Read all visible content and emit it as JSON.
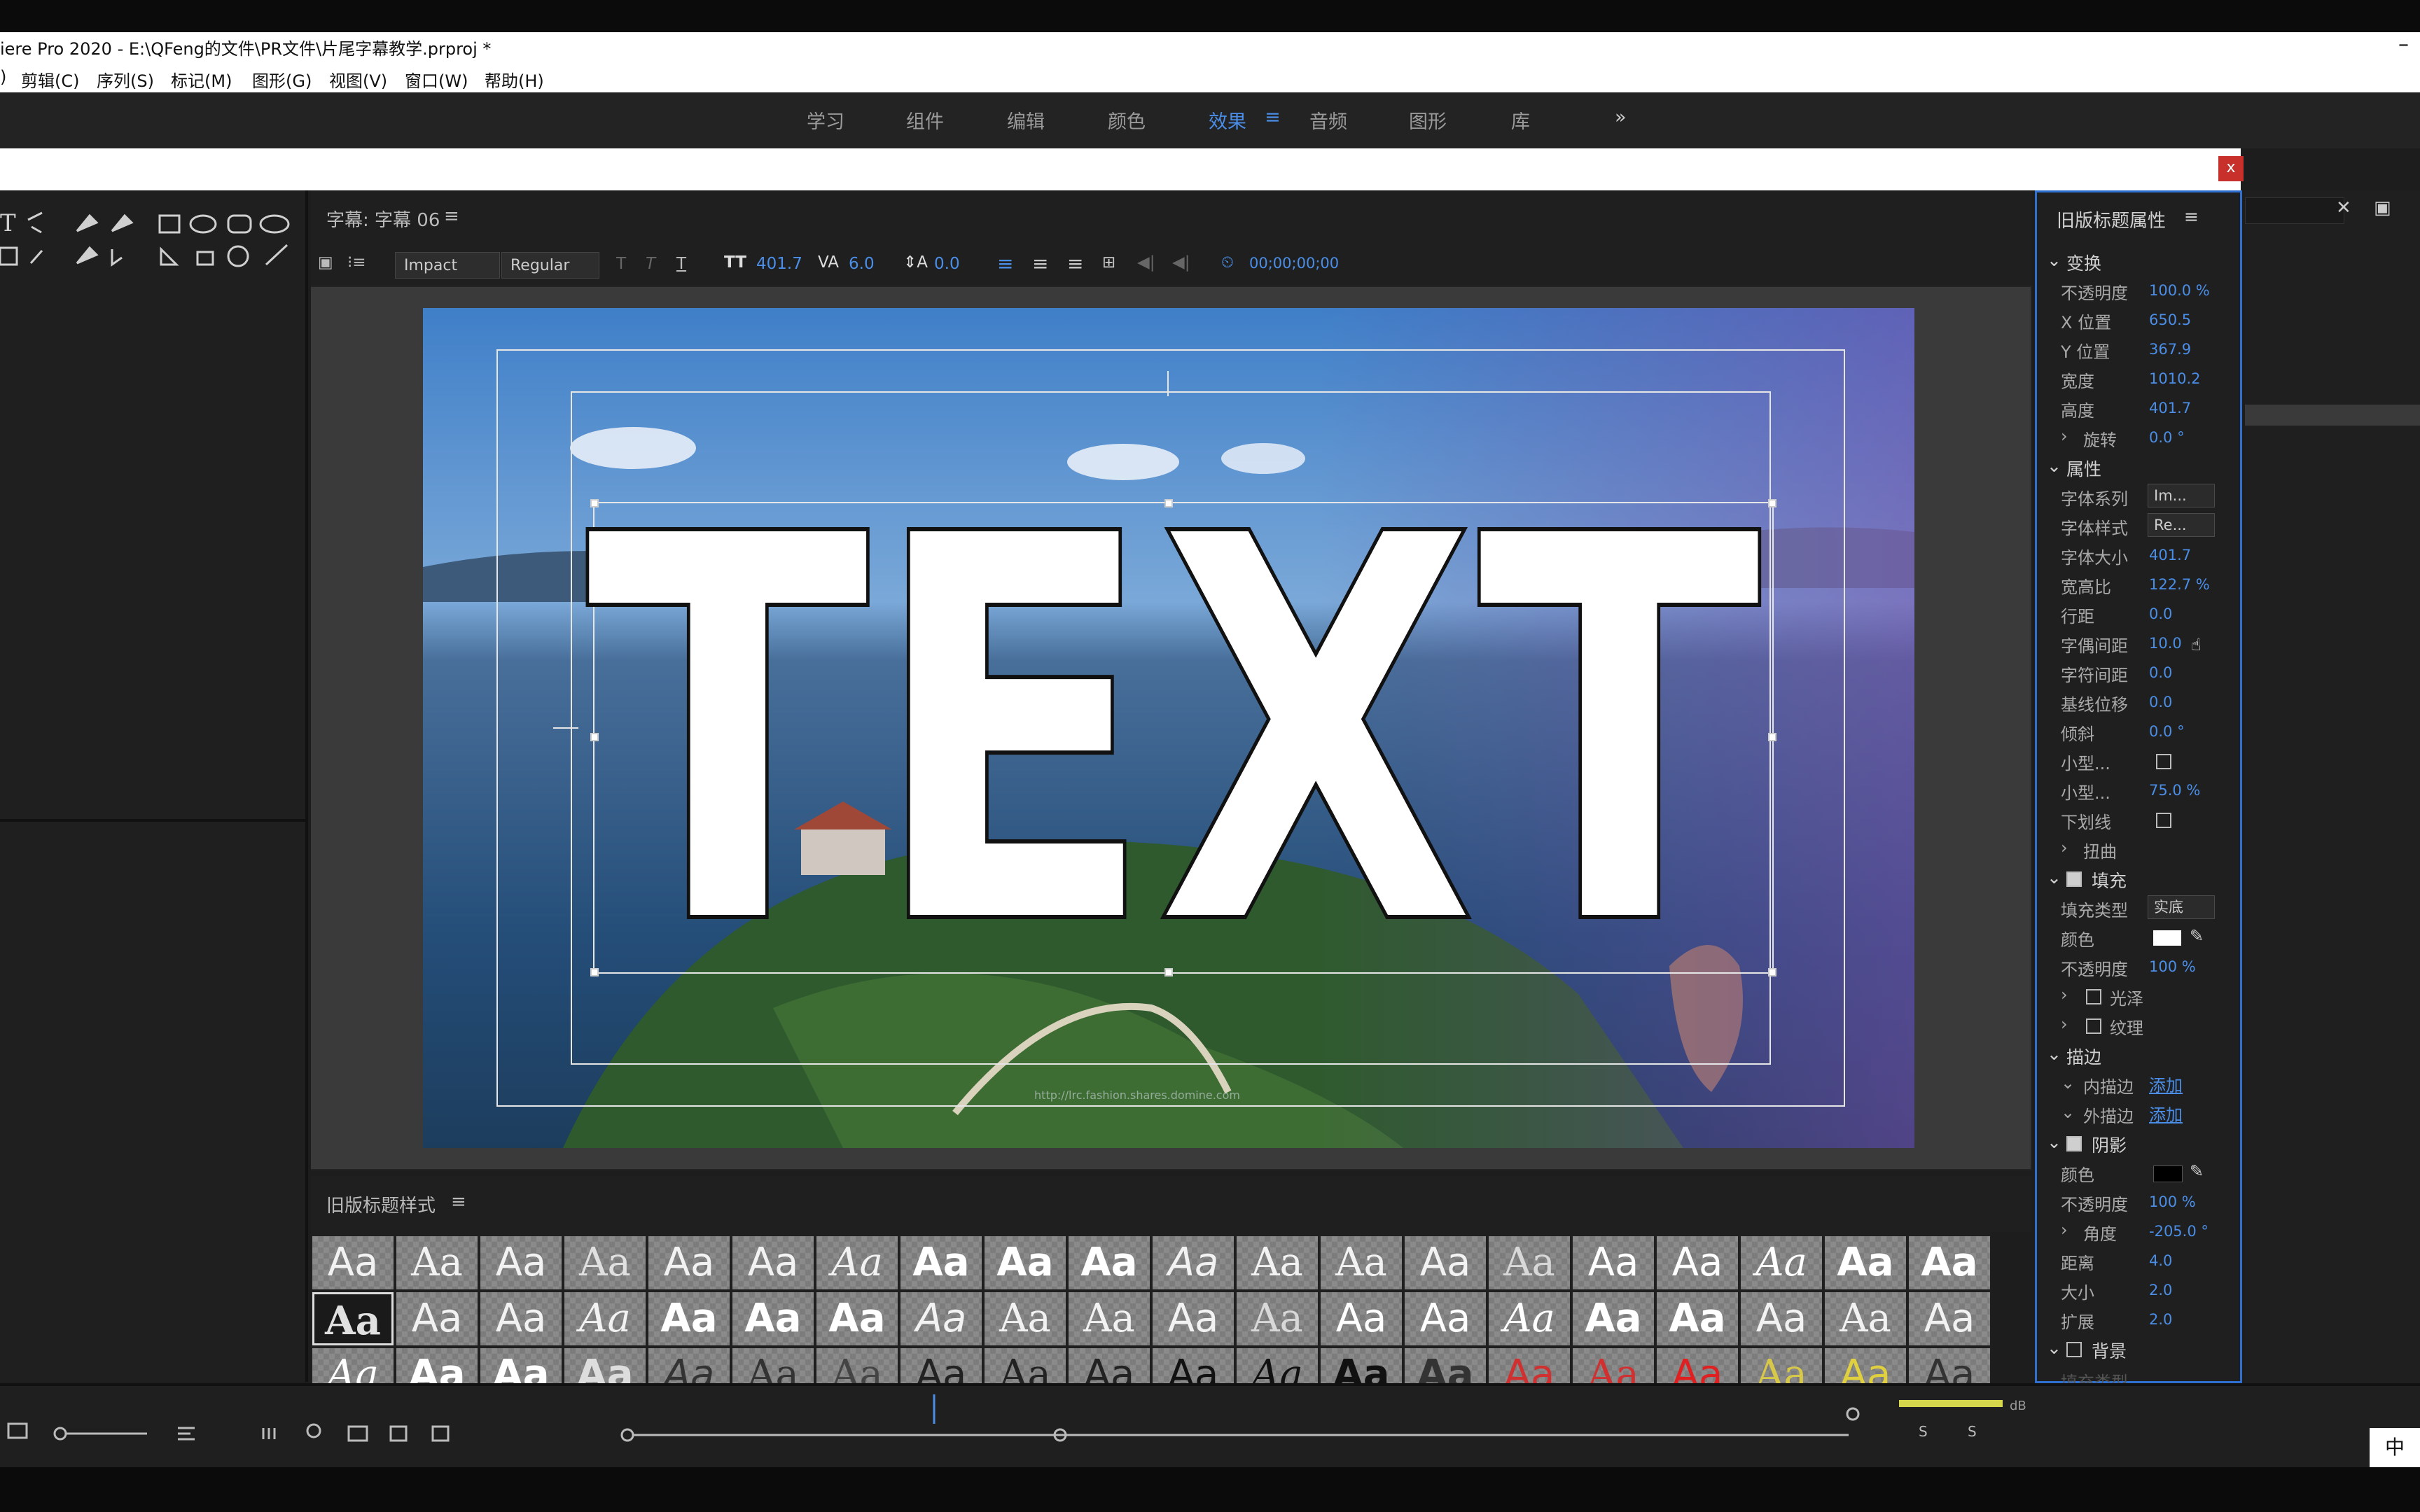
{
  "titlebar": {
    "title": "iere Pro 2020 - E:\\QFeng的文件\\PR文件\\片尾字幕教学.prproj *",
    "minimize": "–"
  },
  "menu": [
    "剪辑(C)",
    "序列(S)",
    "标记(M)",
    "图形(G)",
    "视图(V)",
    "窗口(W)",
    "帮助(H)"
  ],
  "workspaces": {
    "items": [
      "学习",
      "组件",
      "编辑",
      "颜色",
      "效果",
      "音频",
      "图形",
      "库"
    ],
    "active": "效果",
    "more": "»",
    "menu_icon": "≡"
  },
  "close_x": "x",
  "editor": {
    "header": "字幕: 字幕 06",
    "menu_icon": "≡",
    "font_family": "Impact",
    "font_style": "Regular",
    "font_size": "401.7",
    "kerning": "6.0",
    "leading": "0.0",
    "timecode": "00;00;00;00",
    "preview_text": "TEXT",
    "watermark": "http://lrc.fashion.shares.domine.com"
  },
  "styles": {
    "header": "旧版标题样式",
    "menu_icon": "≡",
    "swatch_text": "Aa"
  },
  "props": {
    "header": "旧版标题属性",
    "menu_icon": "≡",
    "transform": {
      "label": "变换",
      "opacity_label": "不透明度",
      "opacity": "100.0 %",
      "x_label": "X 位置",
      "x": "650.5",
      "y_label": "Y 位置",
      "y": "367.9",
      "width_label": "宽度",
      "width": "1010.2",
      "height_label": "高度",
      "height": "401.7",
      "rotation_label": "旋转",
      "rotation": "0.0 °"
    },
    "attributes": {
      "label": "属性",
      "family_label": "字体系列",
      "family": "Im...",
      "style_label": "字体样式",
      "style": "Re...",
      "size_label": "字体大小",
      "size": "401.7",
      "aspect_label": "宽高比",
      "aspect": "122.7 %",
      "leading_label": "行距",
      "leading": "0.0",
      "kerning_label": "字偶间距",
      "kerning": "10.0",
      "tracking_label": "字符间距",
      "tracking": "0.0",
      "baseline_label": "基线位移",
      "baseline": "0.0",
      "slant_label": "倾斜",
      "slant": "0.0 °",
      "smallcaps_label": "小型...",
      "smallcaps_size_label": "小型...",
      "smallcaps_size": "75.0 %",
      "underline_label": "下划线",
      "distort_label": "扭曲"
    },
    "fill": {
      "label": "填充",
      "type_label": "填充类型",
      "type": "实底",
      "color_label": "颜色",
      "opacity_label": "不透明度",
      "opacity": "100 %",
      "sheen_label": "光泽",
      "texture_label": "纹理"
    },
    "strokes": {
      "label": "描边",
      "inner_label": "内描边",
      "outer_label": "外描边",
      "add": "添加"
    },
    "shadow": {
      "label": "阴影",
      "color_label": "颜色",
      "opacity_label": "不透明度",
      "opacity": "100 %",
      "angle_label": "角度",
      "angle": "-205.0 °",
      "distance_label": "距离",
      "distance": "4.0",
      "size_label": "大小",
      "size": "2.0",
      "spread_label": "扩展",
      "spread": "2.0"
    },
    "background": {
      "label": "背景",
      "fill_type_cut": "填充类型"
    }
  },
  "bottom": {
    "db": "dB",
    "s1": "S",
    "s2": "S"
  },
  "ime": "中",
  "colors": {
    "accent": "#4a8ee8",
    "close": "#c8302c"
  }
}
